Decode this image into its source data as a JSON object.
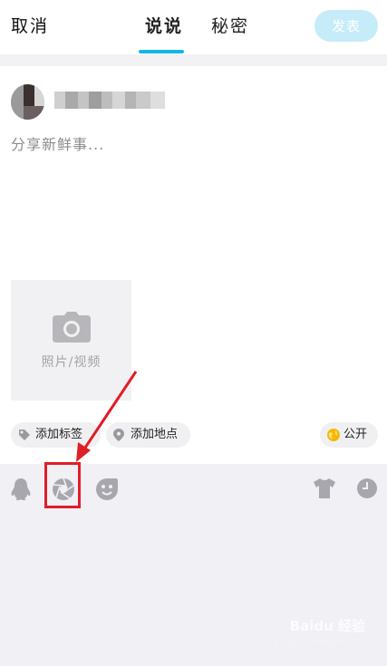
{
  "header": {
    "cancel_label": "取消",
    "tabs": [
      {
        "label": "说说",
        "active": true
      },
      {
        "label": "秘密",
        "active": false
      }
    ],
    "publish_label": "发表",
    "accent_color": "#14b7e8",
    "publish_bg_color": "#c6ecfa"
  },
  "composer": {
    "placeholder": "分享新鲜事..."
  },
  "media": {
    "add_label": "照片/视频",
    "icon": "camera-icon"
  },
  "chips": {
    "tag_label": "添加标签",
    "location_label": "添加地点",
    "privacy_label": "公开"
  },
  "toolbar": {
    "icons": [
      "qq-penguin-icon",
      "shutter-icon",
      "emoji-icon",
      "tshirt-icon",
      "clock-icon"
    ]
  },
  "watermark": {
    "main": "Baidu 经验",
    "sub": "jingyan.baidu.com"
  }
}
